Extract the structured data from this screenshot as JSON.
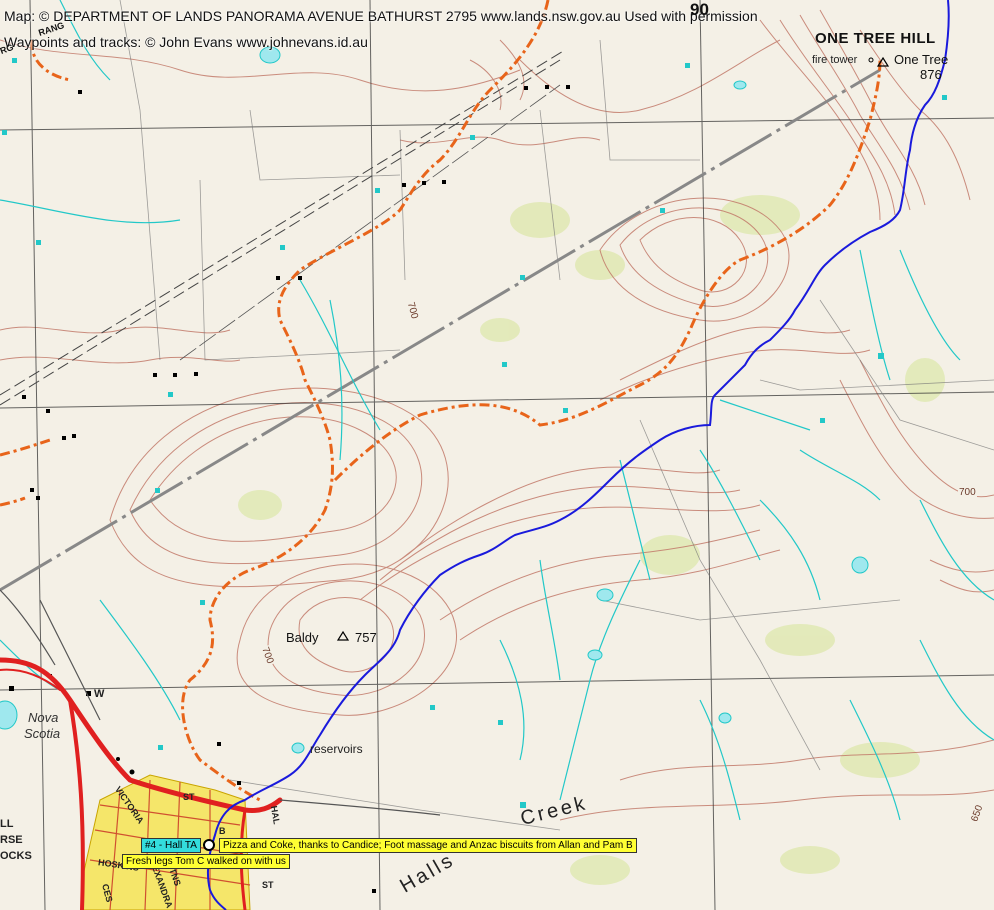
{
  "credits": {
    "map": "Map: © DEPARTMENT OF LANDS PANORAMA AVENUE BATHURST 2795 www.lands.nsw.gov.au  Used with permission",
    "waypoints": "Waypoints and tracks: © John Evans www.johnevans.id.au"
  },
  "grid_label": "90",
  "peaks": {
    "one_tree_hill": "ONE TREE HILL",
    "fire_tower": "fire tower",
    "one_tree": "One Tree",
    "one_tree_height": "876",
    "baldy": "Baldy",
    "baldy_height": "757"
  },
  "contour_labels": {
    "c1": "700",
    "c2": "700",
    "c3": "700",
    "c4": "650"
  },
  "places": {
    "nova": "Nova",
    "scotia": "Scotia",
    "reservoirs": "reservoirs",
    "creek": "Creek",
    "halls": "Halls",
    "w": "W"
  },
  "streets": {
    "victoria": "VICTORIA",
    "st": "ST",
    "hoskins": "HOSKINS",
    "alexandra": "ALEXANDRA",
    "hal": "HAL",
    "st2": "ST",
    "b": "B",
    "ces": "CES",
    "tns": "TNS",
    "rang": "RANG",
    "rg": "RG"
  },
  "edge_text": {
    "l1": "LL",
    "l2": "RSE",
    "l3": "OCKS"
  },
  "waypoint": {
    "id": "#4 - Hall TA",
    "note1": "Pizza and Coke, thanks to Candice; Foot massage and Anzac biscuits from Allan and Pam B",
    "note2": "Fresh legs Tom C walked on with us"
  },
  "colors": {
    "track_blue": "#1a1adc",
    "track_orange": "#e8641a",
    "road_red": "#e02020",
    "built_yellow": "#f5e66a",
    "contour_brown": "#c27a6a",
    "water_cyan": "#22c8c8"
  }
}
